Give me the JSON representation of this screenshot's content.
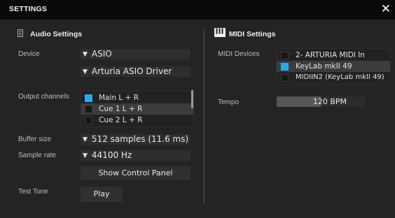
{
  "window": {
    "title": "SETTINGS",
    "close_glyph": "✕"
  },
  "audio": {
    "section_title": "Audio Settings",
    "icon": "audio-settings-icon",
    "device_label": "Device",
    "device_value": "ASIO",
    "driver_value": "Arturia ASIO Driver",
    "output_label": "Output channels",
    "outputs": [
      {
        "label": "Main L + R",
        "checked": true,
        "selected": false
      },
      {
        "label": "Cue 1 L + R",
        "checked": false,
        "selected": true
      },
      {
        "label": "Cue 2 L + R",
        "checked": false,
        "selected": false
      }
    ],
    "buffer_label": "Buffer size",
    "buffer_value": "512 samples (11.6 ms)",
    "samplerate_label": "Sample rate",
    "samplerate_value": "44100 Hz",
    "control_panel_button": "Show Control Panel",
    "test_tone_label": "Test Tone",
    "play_button": "Play"
  },
  "midi": {
    "section_title": "MIDI Settings",
    "icon": "piano-keys-icon",
    "devices_label": "MIDI Devices",
    "devices": [
      {
        "label": "2- ARTURIA MIDI In",
        "checked": false,
        "selected": false
      },
      {
        "label": "KeyLab mkII 49",
        "checked": true,
        "selected": true
      },
      {
        "label": "MIDIIN2 (KeyLab mkII 49)",
        "checked": false,
        "selected": false
      }
    ],
    "tempo_label": "Tempo",
    "tempo_value": "120 BPM",
    "tempo_fraction": 0.5
  },
  "colors": {
    "accent": "#2aa9e8",
    "background": "#242424",
    "titlebar": "#0a0a0a"
  }
}
